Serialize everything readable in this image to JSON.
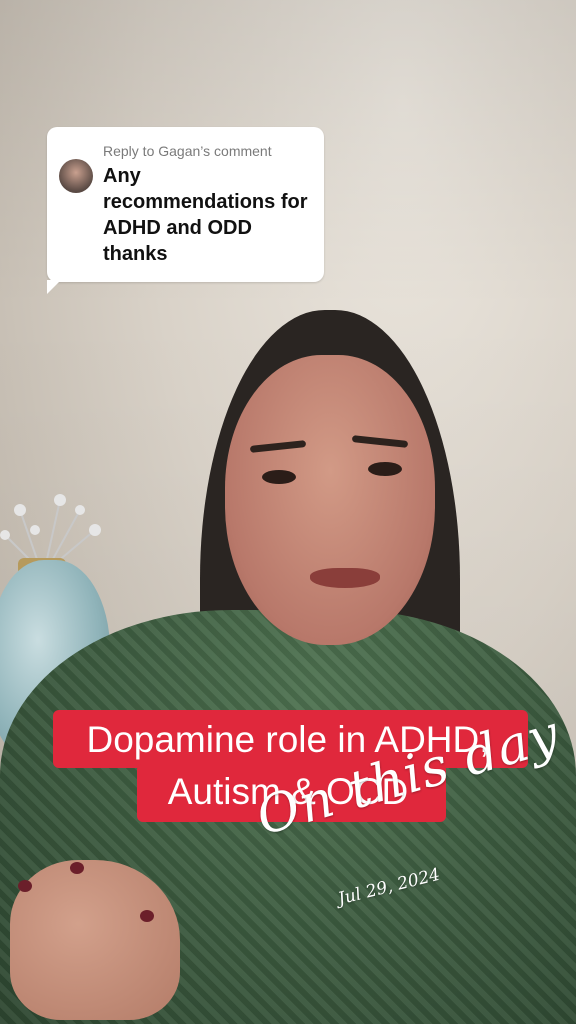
{
  "reply": {
    "header": "Reply to Gagan’s comment",
    "comment": "Any recommendations for ADHD and ODD thanks"
  },
  "caption": {
    "line1": "Dopamine role in ADHD,",
    "line2": "Autism & OCD",
    "color": "#e0283c"
  },
  "stamp": {
    "title": "On this day",
    "date": "Jul 29, 2024"
  }
}
